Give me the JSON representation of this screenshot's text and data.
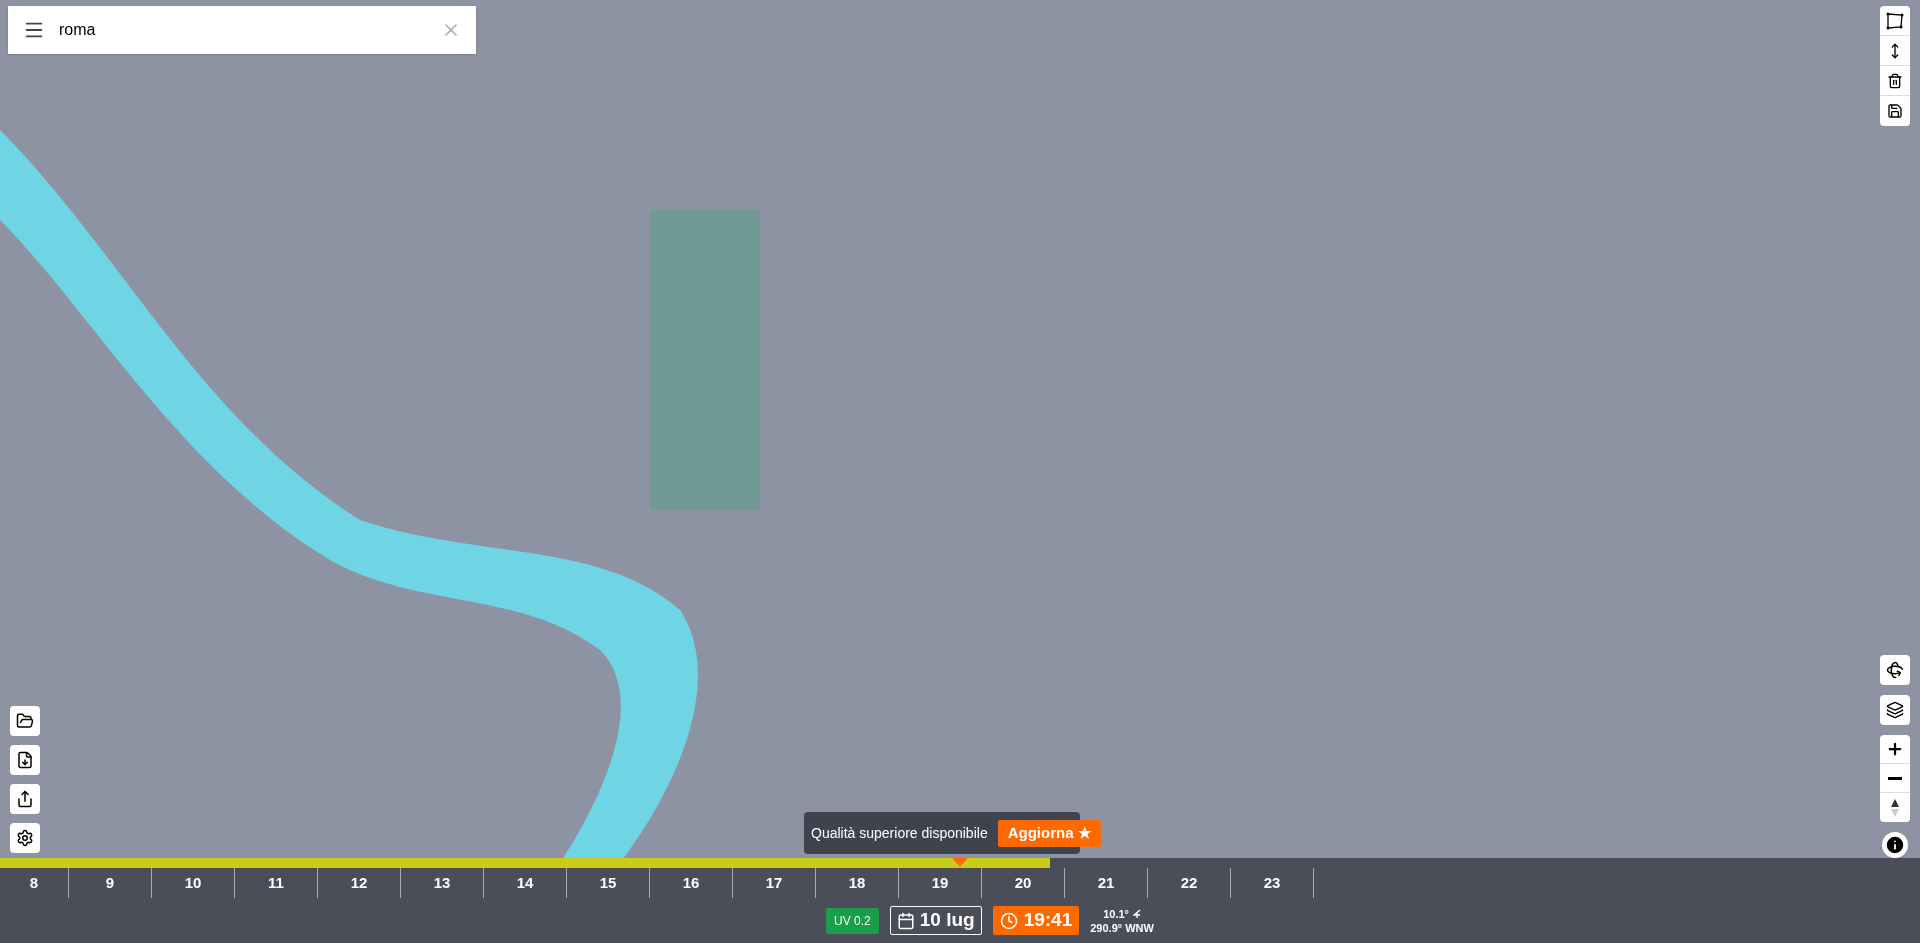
{
  "search": {
    "value": "roma"
  },
  "banner": {
    "text": "Qualità superiore disponibile",
    "button": "Aggiorna ★"
  },
  "timeline": {
    "level": 0.547,
    "cursor": {
      "level": 0.5
    },
    "hours": [
      "8",
      "9",
      "10",
      "11",
      "12",
      "13",
      "14",
      "15",
      "16",
      "17",
      "18",
      "19",
      "20",
      "21",
      "22",
      "23"
    ]
  },
  "status": {
    "uv": "UV 0.2",
    "date": "10 lug",
    "time": "19:41",
    "temperature": "10.1°",
    "direction": "290.9° WNW"
  }
}
